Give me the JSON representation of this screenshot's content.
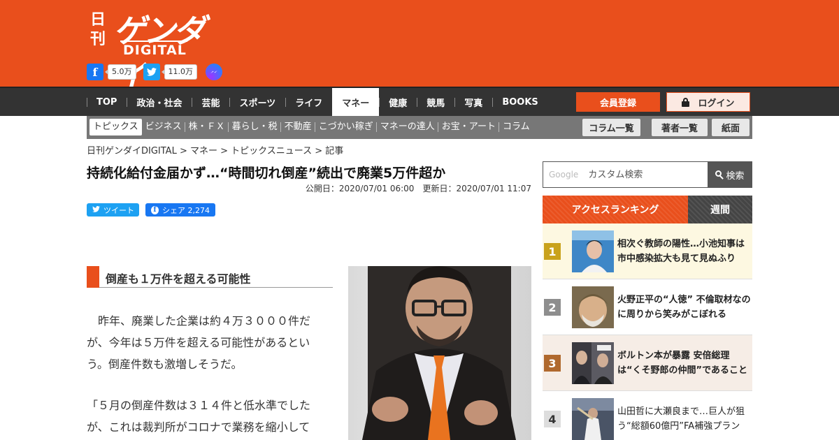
{
  "brand": {
    "logo_small": "日刊",
    "logo_main": "ゲンダイ",
    "logo_sub": "DIGITAL"
  },
  "social_counts": {
    "facebook": "5.0万",
    "twitter": "11.0万"
  },
  "main_nav": [
    "TOP",
    "政治・社会",
    "芸能",
    "スポーツ",
    "ライフ",
    "マネー",
    "健康",
    "競馬",
    "写真",
    "BOOKS"
  ],
  "main_nav_active": "マネー",
  "auth": {
    "register": "会員登録",
    "login": "ログイン"
  },
  "sub_nav": [
    "トピックス",
    "ビジネス",
    "株・ＦＸ",
    "暮らし・税",
    "不動産",
    "こづかい稼ぎ",
    "マネーの達人",
    "お宝・アート",
    "コラム"
  ],
  "sub_buttons": [
    "コラム一覧",
    "著者一覧",
    "紙面"
  ],
  "breadcrumb": "日刊ゲンダイDIGITAL > マネー > トピックスニュース > 記事",
  "article": {
    "title": "持続化給付金届かず…“時間切れ倒産”続出で廃業5万件超か",
    "published": "公開日：2020/07/01 06:00",
    "updated": "更新日：2020/07/01 11:07",
    "tweet_label": "ツイート",
    "share_label": "シェア 2,274",
    "section_heading": "倒産も１万件を超える可能性",
    "paragraph1": "　昨年、廃業した企業は約４万３０００件だが、今年は５万件を超える可能性があるという。倒産件数も激増しそうだ。",
    "paragraph2": "「５月の倒産件数は３１４件と低水準でしたが、これは裁判所がコロナで業務を縮小して"
  },
  "search": {
    "google_label": "Google",
    "placeholder": "カスタム検索",
    "button": "検索"
  },
  "ranking": {
    "tab_access": "アクセスランキング",
    "tab_weekly": "週間",
    "items": [
      {
        "rank": "1",
        "title": "相次ぐ教師の陽性…小池知事は市中感染拡大も見て見ぬふり"
      },
      {
        "rank": "2",
        "title": "火野正平の“人徳” 不倫取材なのに周りから笑みがこぼれる"
      },
      {
        "rank": "3",
        "title": "ボルトン本が暴露 安倍総理は“くそ野郎の仲間”であること"
      },
      {
        "rank": "4",
        "title": "山田哲に大瀬良まで…巨人が狙う“総額60億円”FA補強プラン"
      }
    ]
  },
  "colors": {
    "brand_orange": "#e94f1c",
    "nav_dark": "#333333",
    "rank1_gold": "#c9a21c",
    "rank2_gray": "#8e8e8e",
    "rank3_bronze": "#b0692e",
    "rank4_gray": "#dddddd"
  }
}
